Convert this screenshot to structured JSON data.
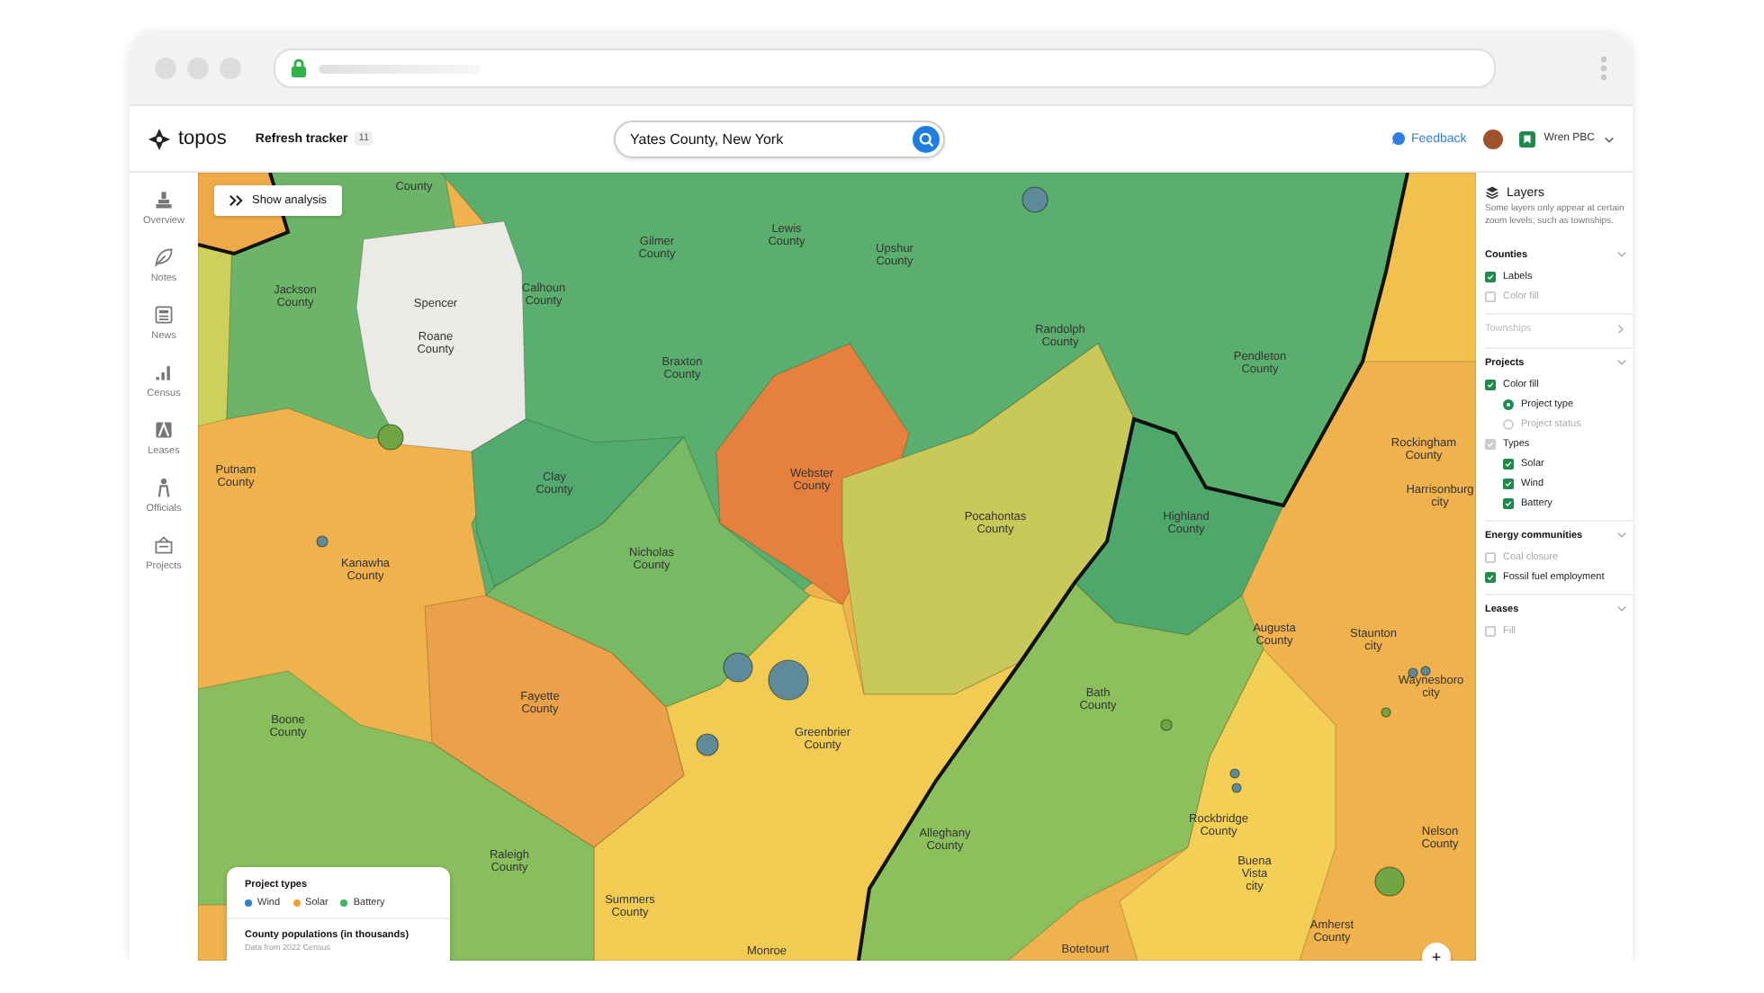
{
  "header": {
    "brand": "topos",
    "tracker": {
      "label": "Refresh tracker",
      "count": "11"
    },
    "search": {
      "value": "Yates County, New York"
    },
    "feedback": "Feedback",
    "workspace": "Wren PBC"
  },
  "nav": [
    {
      "label": "Overview"
    },
    {
      "label": "Notes"
    },
    {
      "label": "News"
    },
    {
      "label": "Census"
    },
    {
      "label": "Leases"
    },
    {
      "label": "Officials"
    },
    {
      "label": "Projects"
    }
  ],
  "map": {
    "show_analysis": "Show analysis",
    "labels": [
      {
        "text": "County"
      },
      {
        "text": "Jackson County"
      },
      {
        "text": "Spencer"
      },
      {
        "text": "Roane County"
      },
      {
        "text": "Calhoun County"
      },
      {
        "text": "Gilmer County"
      },
      {
        "text": "Lewis County"
      },
      {
        "text": "Upshur County"
      },
      {
        "text": "Braxton County"
      },
      {
        "text": "Randolph County"
      },
      {
        "text": "Pendleton County"
      },
      {
        "text": "Putnam County"
      },
      {
        "text": "Clay County"
      },
      {
        "text": "Webster County"
      },
      {
        "text": "Kanawha County"
      },
      {
        "text": "Nicholas County"
      },
      {
        "text": "Pocahontas County"
      },
      {
        "text": "Highland County"
      },
      {
        "text": "Rockingham County"
      },
      {
        "text": "Harrisonburg city"
      },
      {
        "text": "Augusta County"
      },
      {
        "text": "Staunton city"
      },
      {
        "text": "Waynesboro city"
      },
      {
        "text": "Fayette County"
      },
      {
        "text": "Greenbrier County"
      },
      {
        "text": "Boone County"
      },
      {
        "text": "Bath County"
      },
      {
        "text": "Alleghany County"
      },
      {
        "text": "Rockbridge County"
      },
      {
        "text": "Buena Vista city"
      },
      {
        "text": "Nelson County"
      },
      {
        "text": "Raleigh County"
      },
      {
        "text": "Summers County"
      },
      {
        "text": "Amherst County"
      },
      {
        "text": "Monroe"
      },
      {
        "text": "Botetourt"
      }
    ],
    "markers": [
      {
        "color": "#5e8a99"
      },
      {
        "color": "#6fa542"
      },
      {
        "color": "#5e8a99"
      },
      {
        "color": "#5e8a99"
      },
      {
        "color": "#5e8a99"
      },
      {
        "color": "#5e8a99"
      },
      {
        "color": "#5e8a99"
      },
      {
        "color": "#5e8a99"
      },
      {
        "color": "#5e8a99"
      },
      {
        "color": "#5e8a99"
      },
      {
        "color": "#6fa542"
      },
      {
        "color": "#6fa542"
      },
      {
        "color": "#6fa542"
      }
    ],
    "legend": {
      "title": "Project types",
      "items": [
        {
          "label": "Wind",
          "color": "#2f80d8"
        },
        {
          "label": "Solar",
          "color": "#f0a030"
        },
        {
          "label": "Battery",
          "color": "#3db85a"
        }
      ],
      "population_title": "County populations (in thousands)",
      "population_note": "Data from 2022 Census"
    },
    "zoom_in": "+"
  },
  "layers": {
    "title": "Layers",
    "note": "Some layers only appear at certain zoom levels, such as townships.",
    "sections": [
      {
        "title": "Counties",
        "expanded": true,
        "disabled": false,
        "items": [
          {
            "kind": "checkbox",
            "label": "Labels",
            "checked": true,
            "disabled": false
          },
          {
            "kind": "checkbox",
            "label": "Color fill",
            "checked": false,
            "disabled": false
          }
        ]
      },
      {
        "title": "Townships",
        "expanded": false,
        "disabled": true
      },
      {
        "title": "Projects",
        "expanded": true,
        "disabled": false,
        "items": [
          {
            "kind": "checkbox",
            "label": "Color fill",
            "checked": true,
            "disabled": false,
            "children": [
              {
                "kind": "radio",
                "label": "Project type",
                "selected": true
              },
              {
                "kind": "radio",
                "label": "Project status",
                "selected": false
              }
            ]
          },
          {
            "kind": "checkbox",
            "label": "Types",
            "checked": true,
            "disabled": true,
            "children": [
              {
                "kind": "checkbox",
                "label": "Solar",
                "checked": true,
                "disabled": false
              },
              {
                "kind": "checkbox",
                "label": "Wind",
                "checked": true,
                "disabled": false
              },
              {
                "kind": "checkbox",
                "label": "Battery",
                "checked": true,
                "disabled": false
              }
            ]
          }
        ]
      },
      {
        "title": "Energy communities",
        "expanded": true,
        "disabled": false,
        "items": [
          {
            "kind": "checkbox",
            "label": "Coal closure",
            "checked": false,
            "disabled": false
          },
          {
            "kind": "checkbox",
            "label": "Fossil fuel employment",
            "checked": true,
            "disabled": false
          }
        ]
      },
      {
        "title": "Leases",
        "expanded": true,
        "disabled": false,
        "items": [
          {
            "kind": "checkbox",
            "label": "Fill",
            "checked": false,
            "disabled": false
          }
        ]
      }
    ]
  }
}
